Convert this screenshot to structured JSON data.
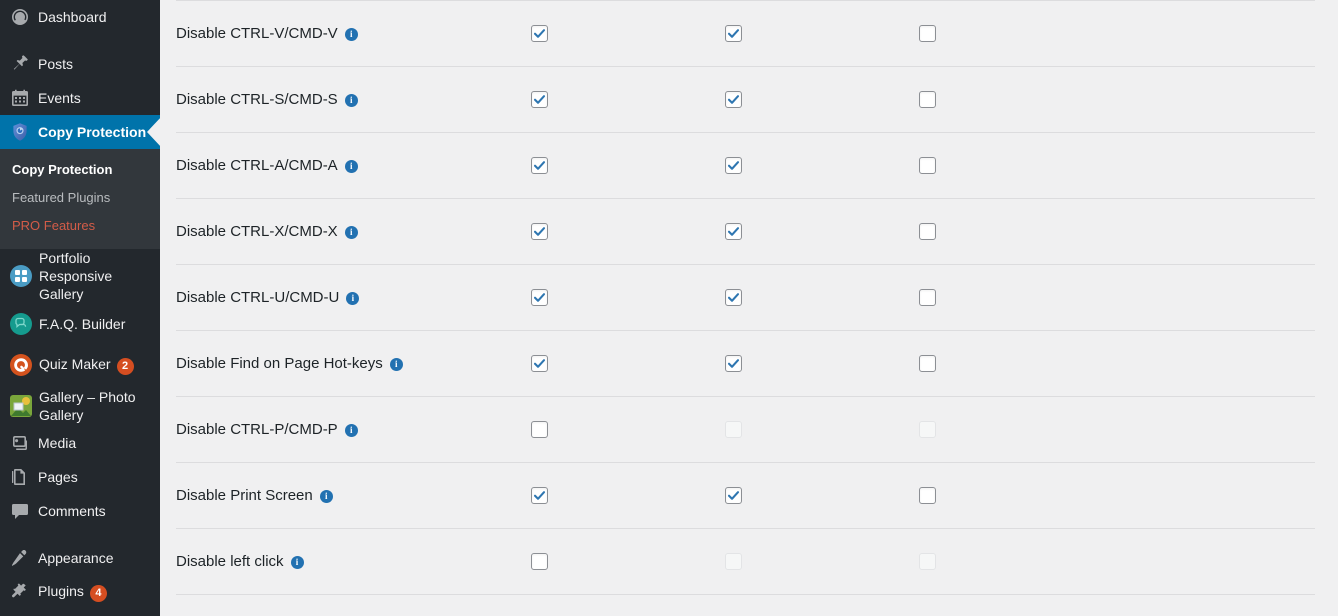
{
  "sidebar": {
    "items": [
      {
        "label": "Dashboard",
        "icon": "dashboard-icon",
        "type": "wp"
      },
      {
        "label": "Posts",
        "icon": "pin-icon",
        "type": "wp",
        "gap": true
      },
      {
        "label": "Events",
        "icon": "calendar-icon",
        "type": "wp"
      },
      {
        "label": "Copy Protection",
        "icon": "shield-icon",
        "type": "plugin-active",
        "active": true
      }
    ],
    "submenu": [
      {
        "label": "Copy Protection",
        "state": "current"
      },
      {
        "label": "Featured Plugins",
        "state": "normal"
      },
      {
        "label": "PRO Features",
        "state": "pro"
      }
    ],
    "plugins": [
      {
        "label": "Portfolio Responsive Gallery",
        "icon": "portfolio-icon",
        "color": "#4a9cc4",
        "shape": "circle",
        "glyph": "portfolio"
      },
      {
        "label": "F.A.Q. Builder",
        "icon": "faq-icon",
        "color": "#159b8e",
        "shape": "circle",
        "glyph": "faq"
      },
      {
        "label": "Quiz Maker",
        "icon": "quiz-icon",
        "color": "#d4531e",
        "shape": "circle",
        "glyph": "quiz",
        "badge": "2"
      },
      {
        "label": "Gallery – Photo Gallery",
        "icon": "gallery-icon",
        "color": "#7aa63b",
        "shape": "square",
        "glyph": "gallery"
      }
    ],
    "lower": [
      {
        "label": "Media",
        "icon": "media-icon",
        "gap": false
      },
      {
        "label": "Pages",
        "icon": "pages-icon",
        "gap": false
      },
      {
        "label": "Comments",
        "icon": "comments-icon",
        "gap": false
      },
      {
        "label": "Appearance",
        "icon": "brush-icon",
        "gap": true
      },
      {
        "label": "Plugins",
        "icon": "plug-icon",
        "gap": false,
        "badge": "4"
      }
    ]
  },
  "settings_table": {
    "rows": [
      {
        "label": "Disable CTRL-V/CMD-V",
        "info": "i",
        "checks": [
          {
            "checked": true,
            "disabled": false
          },
          {
            "checked": true,
            "disabled": false
          },
          {
            "checked": false,
            "disabled": false
          }
        ]
      },
      {
        "label": "Disable CTRL-S/CMD-S",
        "info": "i",
        "checks": [
          {
            "checked": true,
            "disabled": false
          },
          {
            "checked": true,
            "disabled": false
          },
          {
            "checked": false,
            "disabled": false
          }
        ]
      },
      {
        "label": "Disable CTRL-A/CMD-A",
        "info": "i",
        "checks": [
          {
            "checked": true,
            "disabled": false
          },
          {
            "checked": true,
            "disabled": false
          },
          {
            "checked": false,
            "disabled": false
          }
        ]
      },
      {
        "label": "Disable CTRL-X/CMD-X",
        "info": "i",
        "checks": [
          {
            "checked": true,
            "disabled": false
          },
          {
            "checked": true,
            "disabled": false
          },
          {
            "checked": false,
            "disabled": false
          }
        ]
      },
      {
        "label": "Disable CTRL-U/CMD-U",
        "info": "i",
        "checks": [
          {
            "checked": true,
            "disabled": false
          },
          {
            "checked": true,
            "disabled": false
          },
          {
            "checked": false,
            "disabled": false
          }
        ]
      },
      {
        "label": "Disable Find on Page Hot-keys",
        "info": "i",
        "checks": [
          {
            "checked": true,
            "disabled": false
          },
          {
            "checked": true,
            "disabled": false
          },
          {
            "checked": false,
            "disabled": false
          }
        ]
      },
      {
        "label": "Disable CTRL-P/CMD-P",
        "info": "i",
        "checks": [
          {
            "checked": false,
            "disabled": false
          },
          {
            "checked": false,
            "disabled": true
          },
          {
            "checked": false,
            "disabled": true
          }
        ]
      },
      {
        "label": "Disable Print Screen",
        "info": "i",
        "checks": [
          {
            "checked": true,
            "disabled": false
          },
          {
            "checked": true,
            "disabled": false
          },
          {
            "checked": false,
            "disabled": false
          }
        ]
      },
      {
        "label": "Disable left click",
        "info": "i",
        "checks": [
          {
            "checked": false,
            "disabled": false
          },
          {
            "checked": false,
            "disabled": true
          },
          {
            "checked": false,
            "disabled": true
          }
        ]
      }
    ]
  },
  "colors": {
    "sidebar_bg": "#23282d",
    "submenu_bg": "#32373c",
    "active_blue": "#0073aa",
    "badge_orange": "#d54e21",
    "pro_red": "#d35c48",
    "content_bg": "#f0f0f1",
    "divider": "#dcdcde",
    "check_blue": "#2e76b1",
    "info_blue": "#2271b1"
  }
}
